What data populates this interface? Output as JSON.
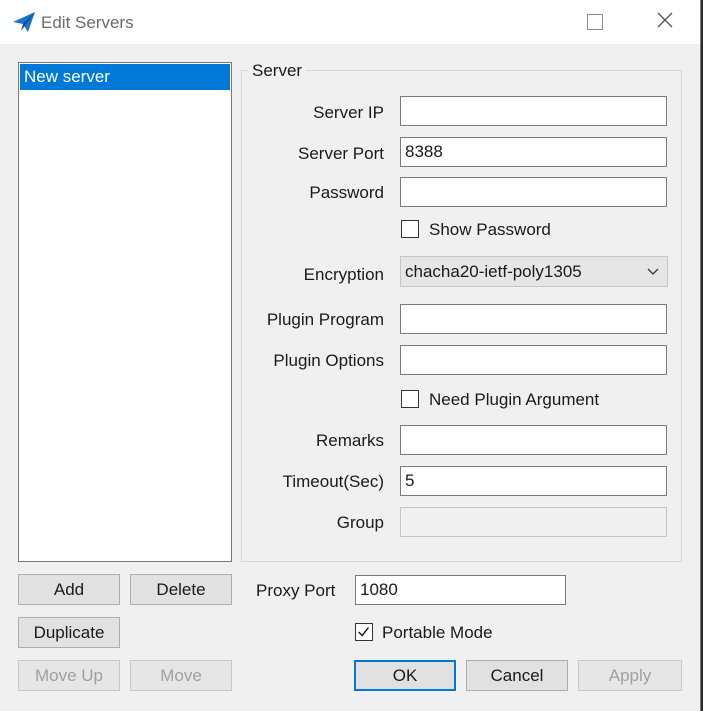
{
  "window": {
    "title": "Edit Servers"
  },
  "server_list": {
    "items": [
      "New server"
    ]
  },
  "server_group": {
    "title": "Server",
    "server_ip_label": "Server IP",
    "server_ip_value": "",
    "server_port_label": "Server Port",
    "server_port_value": "8388",
    "password_label": "Password",
    "password_value": "",
    "show_password_label": "Show Password",
    "show_password_checked": false,
    "encryption_label": "Encryption",
    "encryption_value": "chacha20-ietf-poly1305",
    "plugin_program_label": "Plugin Program",
    "plugin_program_value": "",
    "plugin_options_label": "Plugin Options",
    "plugin_options_value": "",
    "need_plugin_argument_label": "Need Plugin Argument",
    "need_plugin_argument_checked": false,
    "remarks_label": "Remarks",
    "remarks_value": "",
    "timeout_label": "Timeout(Sec)",
    "timeout_value": "5",
    "group_label": "Group",
    "group_value": ""
  },
  "buttons": {
    "add": "Add",
    "delete": "Delete",
    "duplicate": "Duplicate",
    "move_up": "Move Up",
    "move_down": "Move",
    "ok": "OK",
    "cancel": "Cancel",
    "apply": "Apply"
  },
  "proxy": {
    "port_label": "Proxy Port",
    "port_value": "1080",
    "portable_mode_label": "Portable Mode",
    "portable_mode_checked": true
  },
  "colors": {
    "selection": "#0078d7",
    "window_bg": "#f0f0f0"
  }
}
